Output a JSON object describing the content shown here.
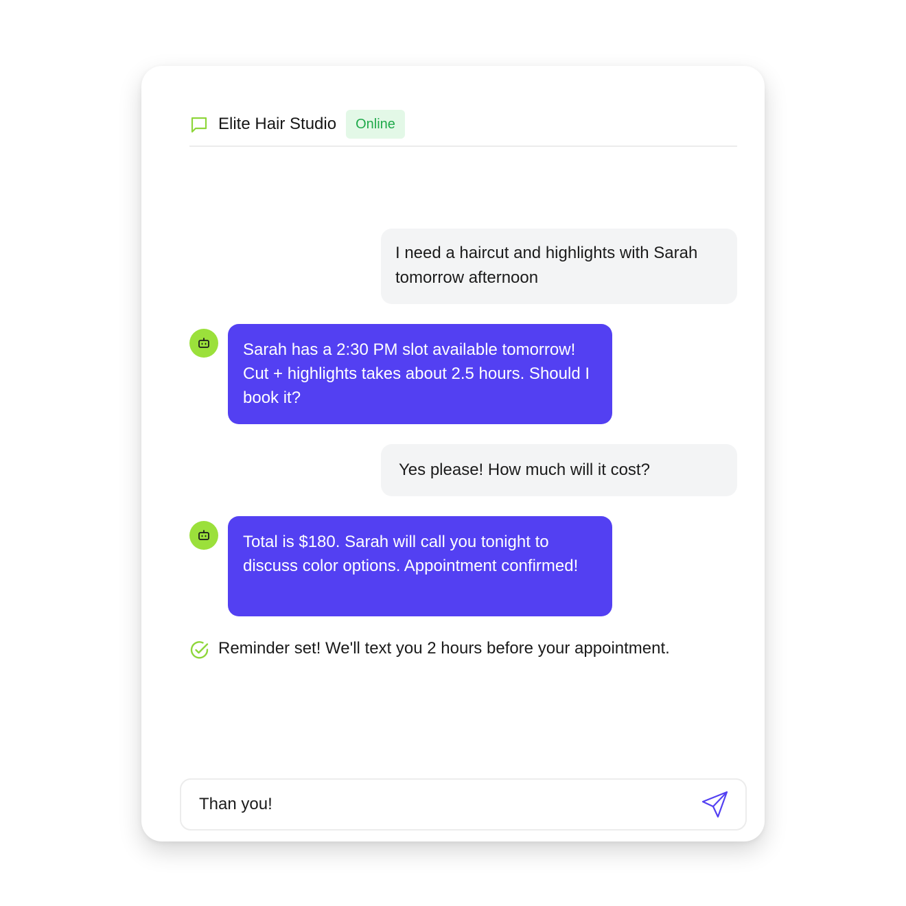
{
  "header": {
    "title": "Elite Hair Studio",
    "status": "Online",
    "icon": "chat-bubble-icon"
  },
  "messages": [
    {
      "sender": "user",
      "text": "I need a haircut and highlights with Sarah tomorrow afternoon"
    },
    {
      "sender": "bot",
      "text": "Sarah has a 2:30 PM slot available tomorrow! Cut + highlights takes about 2.5 hours. Should I book it?"
    },
    {
      "sender": "user",
      "text": "Yes please! How much will it cost?"
    },
    {
      "sender": "bot",
      "text": "Total is $180. Sarah will call you tonight to discuss color options. Appointment confirmed!"
    }
  ],
  "notice": {
    "text": "Reminder set! We'll text you 2 hours before your appointment.",
    "icon": "check-circle-icon"
  },
  "composer": {
    "value": "Than you!",
    "send_icon": "send-icon"
  },
  "colors": {
    "accent": "#5340f2",
    "avatar": "#9be03b",
    "status_bg": "#e3f8e7",
    "status_text": "#1fa94a",
    "user_bubble": "#f3f4f5"
  }
}
